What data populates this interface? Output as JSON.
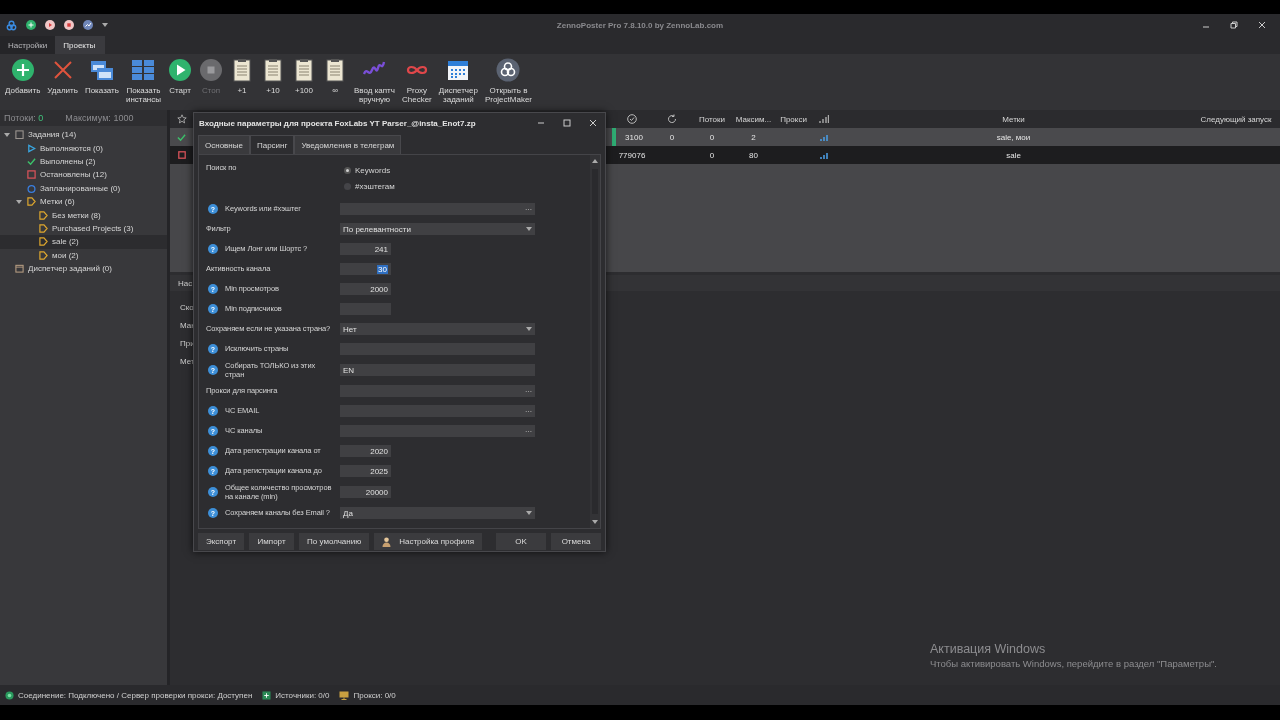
{
  "window": {
    "title": "ZennoPoster Pro 7.8.10.0 by ZennoLab.com"
  },
  "menu_tabs": [
    {
      "label": "Настройки",
      "selected": false
    },
    {
      "label": "Проекты",
      "selected": true
    }
  ],
  "toolbar": [
    {
      "label": "Добавить",
      "kind": "add",
      "disabled": false
    },
    {
      "label": "Удалить",
      "kind": "delete",
      "disabled": false
    },
    {
      "label": "Показать",
      "kind": "windows",
      "disabled": false
    },
    {
      "label": "Показать\nинстансы",
      "kind": "grid",
      "disabled": false
    },
    {
      "label": "Старт",
      "kind": "start",
      "disabled": false
    },
    {
      "label": "Стоп",
      "kind": "stop",
      "disabled": true
    },
    {
      "label": "+1",
      "kind": "clipboard",
      "disabled": false
    },
    {
      "label": "+10",
      "kind": "clipboard",
      "disabled": false
    },
    {
      "label": "+100",
      "kind": "clipboard",
      "disabled": false
    },
    {
      "label": "∞",
      "kind": "clipboard",
      "disabled": false
    },
    {
      "label": "Ввод каптч\nвручную",
      "kind": "captcha",
      "disabled": false
    },
    {
      "label": "Proxy\nChecker",
      "kind": "infinity",
      "disabled": false
    },
    {
      "label": "Диспетчер\nзаданий",
      "kind": "calendar",
      "disabled": false
    },
    {
      "label": "Открыть в\nProjectMaker",
      "kind": "projectmaker",
      "disabled": false
    }
  ],
  "counters": {
    "threads_label": "Потоки:",
    "threads": "0",
    "max_label": "Максимум:",
    "max": "1000"
  },
  "tree": [
    {
      "label": "Задания (14)",
      "kind": "tasks",
      "expanded": true,
      "selected": false,
      "children": [
        {
          "label": "Выполняются (0)",
          "kind": "running",
          "selected": false
        },
        {
          "label": "Выполнены (2)",
          "kind": "done",
          "selected": false
        },
        {
          "label": "Остановлены (12)",
          "kind": "stopped",
          "selected": false
        },
        {
          "label": "Запланированные (0)",
          "kind": "scheduled",
          "selected": false
        },
        {
          "label": "Метки (6)",
          "kind": "tag",
          "expanded": true,
          "selected": false,
          "children": [
            {
              "label": "Без метки (8)",
              "kind": "tag",
              "selected": false
            },
            {
              "label": "Purchased Projects (3)",
              "kind": "tag",
              "selected": false
            },
            {
              "label": "sale (2)",
              "kind": "tag",
              "selected": true
            },
            {
              "label": "мои (2)",
              "kind": "tag",
              "selected": false
            }
          ]
        }
      ]
    },
    {
      "label": "Диспетчер заданий (0)",
      "kind": "dispatcher",
      "selected": false
    }
  ],
  "table": {
    "columns": [
      {
        "kind": "check"
      },
      {
        "kind": "refresh"
      },
      {
        "kind": "text",
        "label": "Потоки"
      },
      {
        "kind": "text",
        "label": "Максим..."
      },
      {
        "kind": "text",
        "label": "Прокси"
      },
      {
        "kind": "signal"
      },
      {
        "kind": "text",
        "label": "Метки"
      },
      {
        "kind": "text",
        "label": "Следующий запуск"
      }
    ],
    "rows": [
      {
        "kind": "done",
        "active": true,
        "selected": false,
        "column_1": "3100",
        "column_2": "0",
        "threads": "0",
        "max": "2",
        "tags": "sale, мои"
      },
      {
        "kind": "stopped",
        "active": false,
        "selected": true,
        "column_1": "779076",
        "threads": "0",
        "max": "80",
        "tags": "sale"
      }
    ]
  },
  "lower_panel": {
    "tab": "Нас",
    "labels": [
      "Ско",
      "Ман",
      "При",
      "Мет"
    ]
  },
  "dialog": {
    "title": "Входные параметры для проекта FoxLabs YT Parser_@insta_Enot7.zp",
    "tabs": [
      {
        "label": "Основные",
        "selected": false
      },
      {
        "label": "Парсинг",
        "selected": true
      },
      {
        "label": "Уведомления в телеграм",
        "selected": false
      }
    ],
    "form": [
      {
        "kind": "radio",
        "label": "Поиск по",
        "options": [
          {
            "label": "Keywords",
            "selected": true
          },
          {
            "label": "#хэштегам",
            "selected": false
          }
        ]
      },
      {
        "kind": "wide_field",
        "help": "?",
        "label": "Keywords или #хэштег",
        "browse": "···"
      },
      {
        "kind": "select",
        "label": "Фильтр",
        "value": "По релевантности"
      },
      {
        "kind": "short_field",
        "help": "?",
        "label": "Ищем Лонг или Шортс ?",
        "value": "241"
      },
      {
        "kind": "short_field",
        "label": "Активность канала",
        "value": "30",
        "highlighted": true
      },
      {
        "kind": "short_field",
        "help": "?",
        "label": "Min просмотров",
        "value": "2000"
      },
      {
        "kind": "short_field",
        "help": "?",
        "label": "Min подписчиков"
      },
      {
        "kind": "select",
        "label": "Сохраняем если не указана страна?",
        "value": "Нет"
      },
      {
        "kind": "wide_field",
        "help": "?",
        "label": "Исключить страны"
      },
      {
        "kind": "wide_field",
        "help": "?",
        "label": "Собирать ТОЛЬКО из этих\nстран",
        "value": "EN"
      },
      {
        "kind": "wide_field",
        "label": "Прокси для парсинга",
        "browse": "···"
      },
      {
        "kind": "wide_field",
        "help": "?",
        "label": "ЧС EMAIL",
        "browse": "···"
      },
      {
        "kind": "wide_field",
        "help": "?",
        "label": "ЧС каналы",
        "browse": "···"
      },
      {
        "kind": "short_field",
        "help": "?",
        "label": "Дата регистрации канала от",
        "value": "2020"
      },
      {
        "kind": "short_field",
        "help": "?",
        "label": "Дата регистрации канала до",
        "value": "2025"
      },
      {
        "kind": "short_field",
        "help": "?",
        "label": "Общее количество просмотров\nна канале (min)",
        "value": "20000"
      },
      {
        "kind": "select",
        "help": "?",
        "label": "Сохраняем каналы без Email ?",
        "value": "Да"
      }
    ],
    "buttons": [
      {
        "label": "Экспорт",
        "kind": "plain"
      },
      {
        "label": "Импорт",
        "kind": "plain"
      },
      {
        "label": "По умолчанию",
        "kind": "plain"
      },
      {
        "label": "Настройка профиля",
        "kind": "profile"
      },
      {
        "label": "OK",
        "kind": "confirm"
      },
      {
        "label": "Отмена",
        "kind": "confirm"
      }
    ]
  },
  "status_bar": [
    {
      "kind": "connection",
      "text": "Соединение: Подключено / Сервер проверки прокси: Доступен"
    },
    {
      "kind": "sources",
      "text": "Источники: 0/0"
    },
    {
      "kind": "proxy",
      "text": "Прокси: 0/0"
    }
  ],
  "os_notice": {
    "title": "Активация Windows",
    "text": "Чтобы активировать Windows, перейдите в раздел \"Параметры\"."
  }
}
